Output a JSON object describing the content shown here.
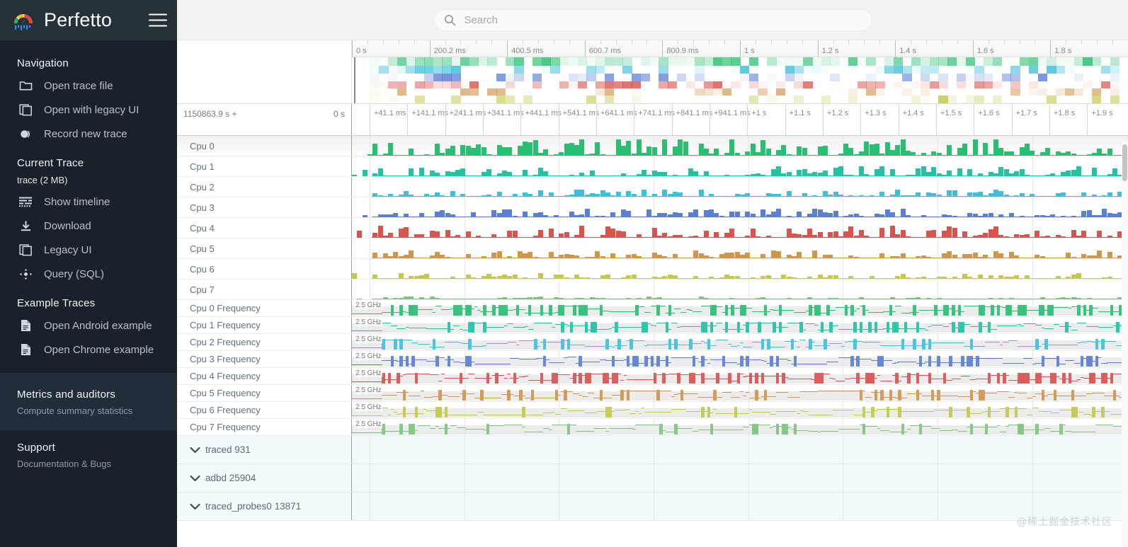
{
  "app": {
    "brand": "Perfetto",
    "logo_icon": "perfetto-gauge-logo",
    "menu_icon": "hamburger-menu-icon"
  },
  "search": {
    "placeholder": "Search",
    "value": "",
    "icon": "search-icon"
  },
  "sidebar": {
    "sections": [
      {
        "title": "Navigation",
        "items": [
          {
            "label": "Open trace file",
            "icon": "folder-open-icon"
          },
          {
            "label": "Open with legacy UI",
            "icon": "copy-window-icon"
          },
          {
            "label": "Record new trace",
            "icon": "record-circle-icon"
          }
        ]
      },
      {
        "title": "Current Trace",
        "trace_name": "trace (2 MB)",
        "items": [
          {
            "label": "Show timeline",
            "icon": "timeline-icon"
          },
          {
            "label": "Download",
            "icon": "download-icon"
          },
          {
            "label": "Legacy UI",
            "icon": "copy-window-icon"
          },
          {
            "label": "Query (SQL)",
            "icon": "query-sql-icon"
          }
        ]
      },
      {
        "title": "Example Traces",
        "items": [
          {
            "label": "Open Android example",
            "icon": "document-icon"
          },
          {
            "label": "Open Chrome example",
            "icon": "document-icon"
          }
        ]
      },
      {
        "title": "Metrics and auditors",
        "subtitle": "Compute summary statistics",
        "highlighted": true,
        "items": []
      },
      {
        "title": "Support",
        "subtitle": "Documentation & Bugs",
        "items": []
      }
    ]
  },
  "overview": {
    "ruler_labels": [
      "0 s",
      "200.2 ms",
      "400.5 ms",
      "600.7 ms",
      "800.9 ms",
      "1 s",
      "1.2 s",
      "1.4 s",
      "1.6 s",
      "1.8 s"
    ],
    "minor_ticks_per_label": 5
  },
  "timeruler": {
    "trace_start": "1150863.9 s +",
    "origin": "0 s",
    "labels": [
      "+41.1 ms",
      "+141.1 ms",
      "+241.1 ms",
      "+341.1 ms",
      "+441.1 ms",
      "+541.1 ms",
      "+641.1 ms",
      "+741.1 ms",
      "+841.1 ms",
      "+941.1 ms",
      "+1 s",
      "+1.1 s",
      "+1.2 s",
      "+1.3 s",
      "+1.4 s",
      "+1.5 s",
      "+1.6 s",
      "+1.7 s",
      "+1.8 s",
      "+1.9 s"
    ]
  },
  "tracks": {
    "cpu_tracks": [
      {
        "label": "Cpu 0",
        "color": "#29bf72",
        "seed": 11,
        "amp": 0.95
      },
      {
        "label": "Cpu 1",
        "color": "#22c2a3",
        "seed": 23,
        "amp": 0.58
      },
      {
        "label": "Cpu 2",
        "color": "#3ec0dd",
        "seed": 37,
        "amp": 0.42
      },
      {
        "label": "Cpu 3",
        "color": "#5b7fd4",
        "seed": 51,
        "amp": 0.5
      },
      {
        "label": "Cpu 4",
        "color": "#d9534f",
        "seed": 67,
        "amp": 0.7
      },
      {
        "label": "Cpu 5",
        "color": "#d2954c",
        "seed": 83,
        "amp": 0.45
      },
      {
        "label": "Cpu 6",
        "color": "#c2ca49",
        "seed": 97,
        "amp": 0.32
      },
      {
        "label": "Cpu 7",
        "color": "#7ec47e",
        "seed": 113,
        "amp": 0.16
      }
    ],
    "freq_tracks": [
      {
        "label": "Cpu 0 Frequency",
        "scale": "2.5 GHz",
        "color": "#29bf72",
        "seed": 5,
        "density": 0.85
      },
      {
        "label": "Cpu 1 Frequency",
        "scale": "2.5 GHz",
        "color": "#22c2a3",
        "seed": 15,
        "density": 0.55
      },
      {
        "label": "Cpu 2 Frequency",
        "scale": "2.5 GHz",
        "color": "#3ec0dd",
        "seed": 25,
        "density": 0.45
      },
      {
        "label": "Cpu 3 Frequency",
        "scale": "2.5 GHz",
        "color": "#5b7fd4",
        "seed": 35,
        "density": 0.72
      },
      {
        "label": "Cpu 4 Frequency",
        "scale": "2.5 GHz",
        "color": "#d9534f",
        "seed": 45,
        "density": 0.8
      },
      {
        "label": "Cpu 5 Frequency",
        "scale": "2.5 GHz",
        "color": "#d2954c",
        "seed": 55,
        "density": 0.4
      },
      {
        "label": "Cpu 6 Frequency",
        "scale": "2.5 GHz",
        "color": "#c2ca49",
        "seed": 65,
        "density": 0.35
      },
      {
        "label": "Cpu 7 Frequency",
        "scale": "2.5 GHz",
        "color": "#7ec47e",
        "seed": 75,
        "density": 0.3
      }
    ],
    "process_groups": [
      {
        "label": "traced 931",
        "expand_icon": "chevron-down-icon"
      },
      {
        "label": "adbd 25904",
        "expand_icon": "chevron-down-icon"
      },
      {
        "label": "traced_probes0 13871",
        "expand_icon": "chevron-down-icon"
      }
    ]
  },
  "watermark": {
    "text": "@稀土掘金技术社区"
  },
  "colors": {
    "sidebar_bg": "#19212b",
    "sidebar_header_bg": "#263238",
    "accent_green": "#29bf72",
    "group_bg": "#f2f9fb"
  }
}
